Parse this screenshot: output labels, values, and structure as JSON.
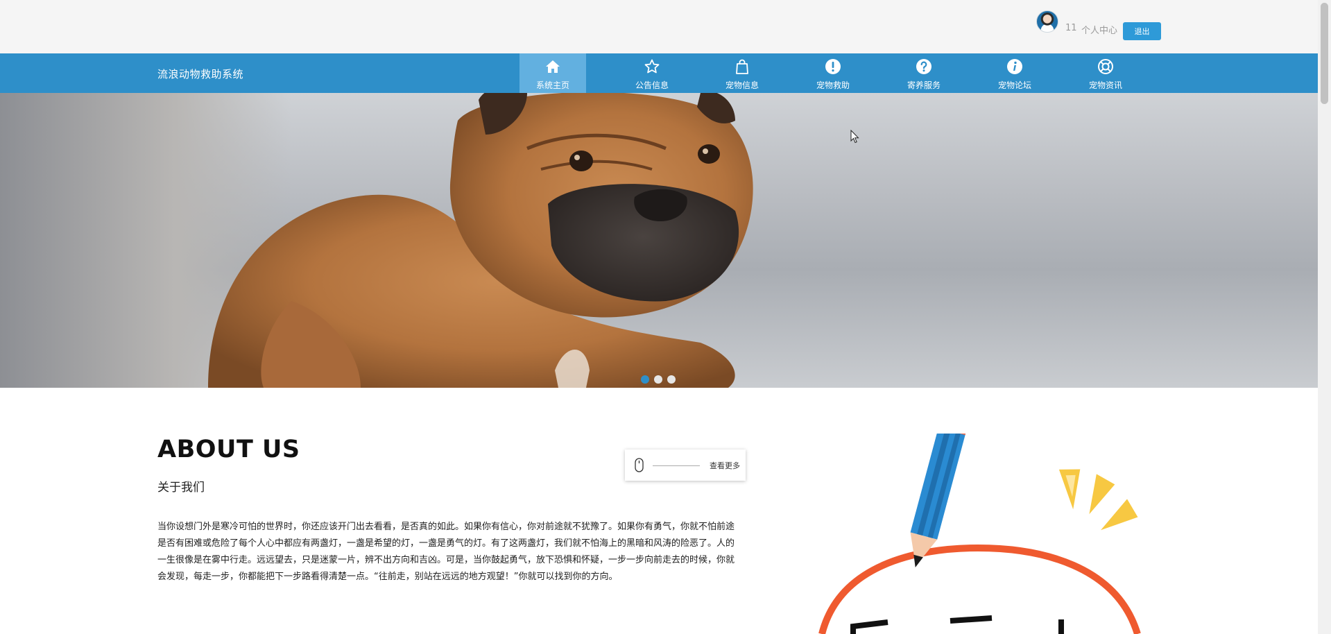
{
  "header": {
    "username": "11",
    "user_center_label": "个人中心",
    "logout_label": "退出"
  },
  "nav": {
    "brand": "流浪动物救助系统",
    "items": [
      {
        "label": "系统主页",
        "icon": "home-icon",
        "active": true
      },
      {
        "label": "公告信息",
        "icon": "star-icon",
        "active": false
      },
      {
        "label": "宠物信息",
        "icon": "bag-icon",
        "active": false
      },
      {
        "label": "宠物救助",
        "icon": "exclamation-icon",
        "active": false
      },
      {
        "label": "寄养服务",
        "icon": "question-icon",
        "active": false
      },
      {
        "label": "宠物论坛",
        "icon": "info-icon",
        "active": false
      },
      {
        "label": "宠物资讯",
        "icon": "lifebuoy-icon",
        "active": false
      }
    ],
    "accent_color": "#2e8fc9"
  },
  "carousel": {
    "slides": 3,
    "active_index": 0
  },
  "about": {
    "title": "ABOUT US",
    "subtitle": "关于我们",
    "more_label": "查看更多",
    "text": "当你设想门外是寒冷可怕的世界时，你还应该开门出去看看，是否真的如此。如果你有信心，你对前途就不犹豫了。如果你有勇气，你就不怕前途是否有困难或危险了每个人心中都应有两盏灯，一盏是希望的灯，一盏是勇气的灯。有了这两盏灯，我们就不怕海上的黑暗和风涛的险恶了。人的一生很像是在雾中行走。远远望去，只是迷蒙一片，辨不出方向和吉凶。可是，当你鼓起勇气，放下恐惧和怀疑，一步一步向前走去的时候，你就会发现，每走一步，你都能把下一步路看得清楚一点。“往前走，别站在远远的地方观望！”你就可以找到你的方向。"
  }
}
